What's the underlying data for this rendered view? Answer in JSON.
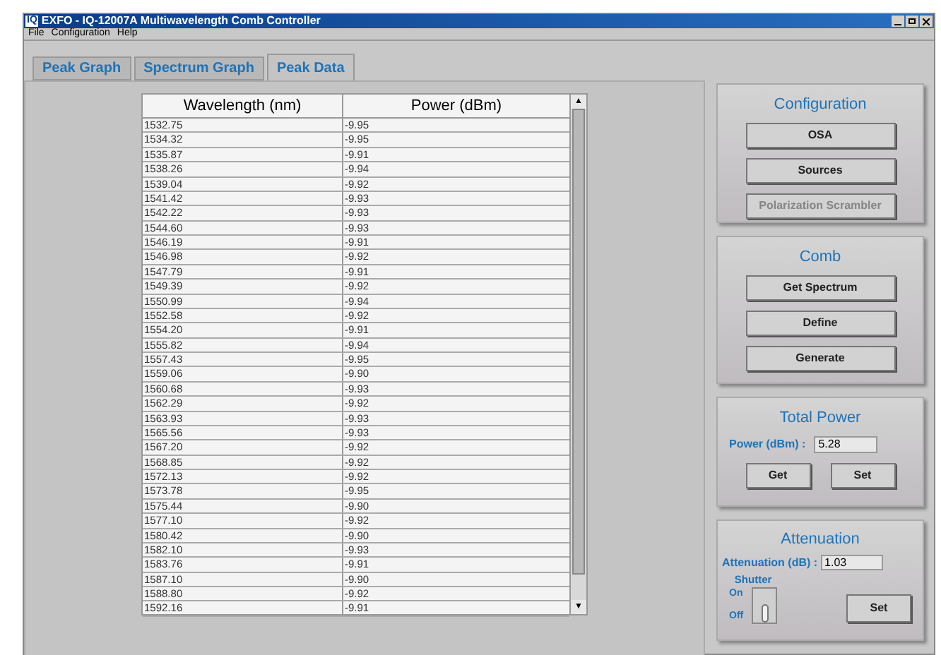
{
  "window": {
    "title": "IQ",
    "title_text": "EXFO - IQ-12007A Multiwavelength Comb Controller"
  },
  "menu": [
    "File",
    "Configuration",
    "Help"
  ],
  "tabs": [
    {
      "label": "Peak Graph",
      "selected": false
    },
    {
      "label": "Spectrum Graph",
      "selected": false
    },
    {
      "label": "Peak Data",
      "selected": true
    }
  ],
  "table": {
    "columns": [
      "Wavelength (nm)",
      "Power (dBm)"
    ],
    "rows": [
      [
        "1532.75",
        "-9.95"
      ],
      [
        "1534.32",
        "-9.95"
      ],
      [
        "1535.87",
        "-9.91"
      ],
      [
        "1538.26",
        "-9.94"
      ],
      [
        "1539.04",
        "-9.92"
      ],
      [
        "1541.42",
        "-9.93"
      ],
      [
        "1542.22",
        "-9.93"
      ],
      [
        "1544.60",
        "-9.93"
      ],
      [
        "1546.19",
        "-9.91"
      ],
      [
        "1546.98",
        "-9.92"
      ],
      [
        "1547.79",
        "-9.91"
      ],
      [
        "1549.39",
        "-9.92"
      ],
      [
        "1550.99",
        "-9.94"
      ],
      [
        "1552.58",
        "-9.92"
      ],
      [
        "1554.20",
        "-9.91"
      ],
      [
        "1555.82",
        "-9.94"
      ],
      [
        "1557.43",
        "-9.95"
      ],
      [
        "1559.06",
        "-9.90"
      ],
      [
        "1560.68",
        "-9.93"
      ],
      [
        "1562.29",
        "-9.92"
      ],
      [
        "1563.93",
        "-9.93"
      ],
      [
        "1565.56",
        "-9.93"
      ],
      [
        "1567.20",
        "-9.92"
      ],
      [
        "1568.85",
        "-9.92"
      ],
      [
        "1572.13",
        "-9.92"
      ],
      [
        "1573.78",
        "-9.95"
      ],
      [
        "1575.44",
        "-9.90"
      ],
      [
        "1577.10",
        "-9.92"
      ],
      [
        "1580.42",
        "-9.90"
      ],
      [
        "1582.10",
        "-9.93"
      ],
      [
        "1583.76",
        "-9.91"
      ],
      [
        "1587.10",
        "-9.90"
      ],
      [
        "1588.80",
        "-9.92"
      ],
      [
        "1592.16",
        "-9.91"
      ]
    ],
    "scroll_up": "▲",
    "scroll_down": "▼"
  },
  "configuration": {
    "title": "Configuration",
    "buttons": [
      {
        "label": "OSA",
        "disabled": false
      },
      {
        "label": "Sources",
        "disabled": false
      },
      {
        "label": "Polarization Scrambler",
        "disabled": true
      }
    ]
  },
  "comb": {
    "title": "Comb",
    "buttons": [
      {
        "label": "Get Spectrum",
        "disabled": false
      },
      {
        "label": "Define",
        "disabled": false
      },
      {
        "label": "Generate",
        "disabled": false
      }
    ]
  },
  "total_power": {
    "title": "Total Power",
    "label": "Power (dBm) :",
    "value": "5.28",
    "buttons": [
      "Get",
      "Set"
    ]
  },
  "attenuation": {
    "title": "Attenuation",
    "label": "Attenuation (dB) :",
    "value": "1.03",
    "shutter": {
      "label": "Shutter",
      "on_label": "On",
      "off_label": "Off",
      "on": false
    },
    "button": "Set"
  }
}
